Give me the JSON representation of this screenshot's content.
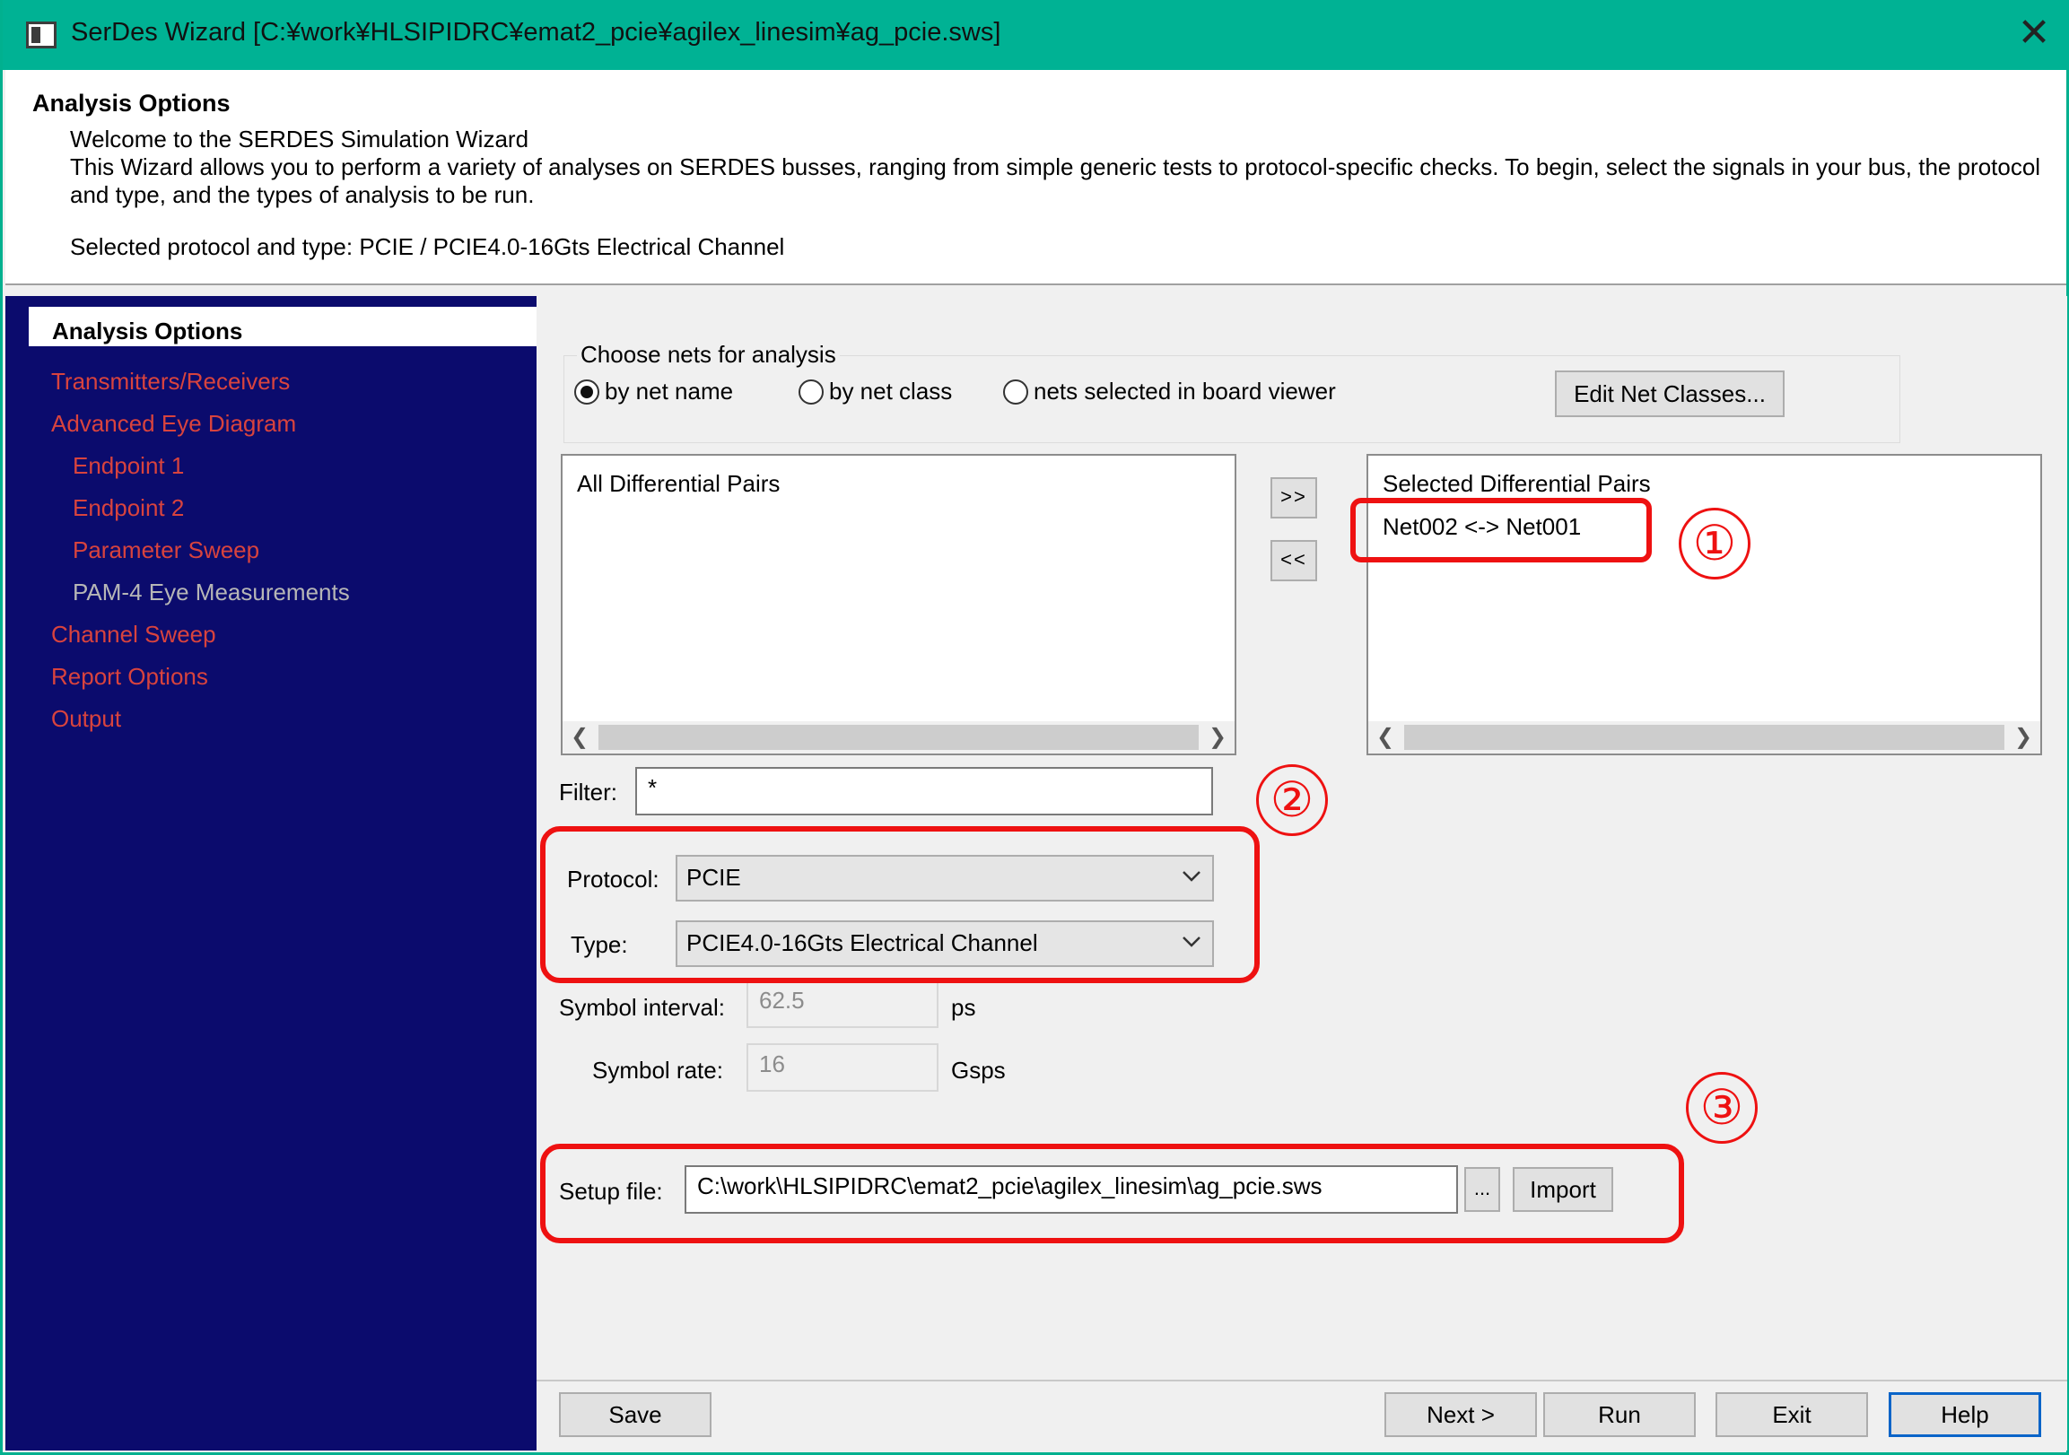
{
  "window": {
    "title": "SerDes Wizard [C:¥work¥HLSIPIDRC¥emat2_pcie¥agilex_linesim¥ag_pcie.sws]",
    "close_glyph": "✕"
  },
  "header": {
    "title": "Analysis Options",
    "welcome": "Welcome to the SERDES Simulation Wizard",
    "description": "This Wizard allows you to perform a variety of analyses on SERDES busses, ranging from simple generic tests to protocol-specific checks.  To begin, select the signals in your bus, the protocol and type, and the types of analysis to be run.",
    "selected_protocol": "Selected protocol and type: PCIE / PCIE4.0-16Gts Electrical Channel"
  },
  "sidebar": {
    "items": [
      {
        "label": "Analysis Options"
      },
      {
        "label": "Transmitters/Receivers"
      },
      {
        "label": "Advanced Eye Diagram"
      },
      {
        "label": "Endpoint 1"
      },
      {
        "label": "Endpoint 2"
      },
      {
        "label": "Parameter Sweep"
      },
      {
        "label": "PAM-4 Eye Measurements"
      },
      {
        "label": "Channel Sweep"
      },
      {
        "label": "Report Options"
      },
      {
        "label": "Output"
      }
    ]
  },
  "nets": {
    "group_label": "Choose nets for analysis",
    "radio_options": [
      "by net name",
      "by net class",
      "nets selected in board viewer"
    ],
    "selected_option": "by net name",
    "edit_classes_label": "Edit Net Classes...",
    "all_pairs_title": "All Differential Pairs",
    "selected_pairs_title": "Selected Differential Pairs",
    "selected_pairs": [
      "Net002 <-> Net001"
    ],
    "add_label": ">>",
    "remove_label": "<<",
    "filter_label": "Filter:",
    "filter_value": "*"
  },
  "protocol": {
    "protocol_label": "Protocol:",
    "protocol_value": "PCIE",
    "type_label": "Type:",
    "type_value": "PCIE4.0-16Gts Electrical Channel",
    "symbol_interval_label": "Symbol interval:",
    "symbol_interval_value": "62.5",
    "symbol_interval_unit": "ps",
    "symbol_rate_label": "Symbol rate:",
    "symbol_rate_value": "16",
    "symbol_rate_unit": "Gsps"
  },
  "setup": {
    "label": "Setup file:",
    "value": "C:\\work\\HLSIPIDRC\\emat2_pcie\\agilex_linesim\\ag_pcie.sws",
    "browse_label": "...",
    "import_label": "Import"
  },
  "annotations": [
    "①",
    "②",
    "③"
  ],
  "footer": {
    "save": "Save",
    "next": "Next >",
    "run": "Run",
    "exit": "Exit",
    "help": "Help"
  },
  "colors": {
    "titlebar": "#00b294",
    "sidebar_bg": "#0b0b6d",
    "nav_link": "#d8433e",
    "highlight": "#ee1111"
  }
}
